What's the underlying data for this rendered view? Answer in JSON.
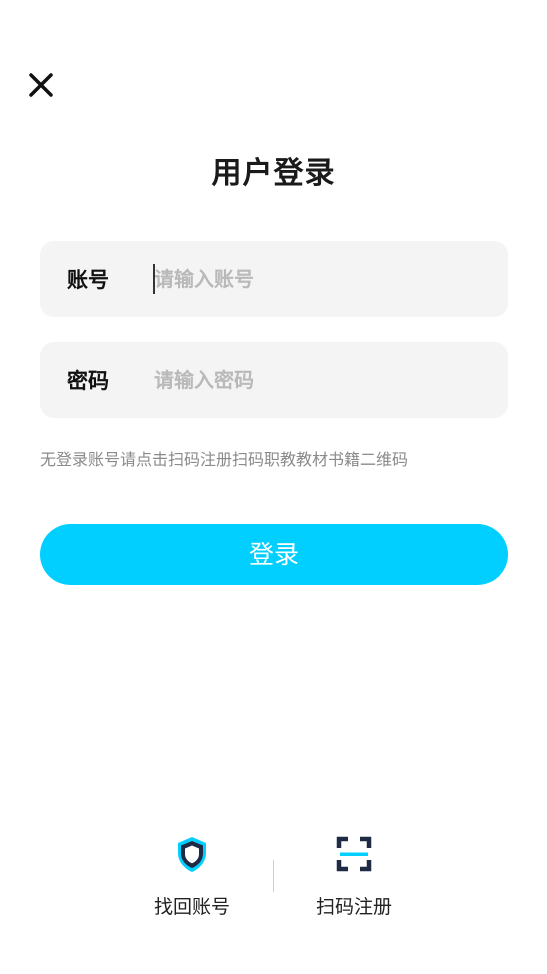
{
  "header": {
    "title": "用户登录"
  },
  "form": {
    "account": {
      "label": "账号",
      "placeholder": "请输入账号"
    },
    "password": {
      "label": "密码",
      "placeholder": "请输入密码"
    },
    "hint": "无登录账号请点击扫码注册扫码职教教材书籍二维码",
    "login_label": "登录"
  },
  "bottom": {
    "recover_label": "找回账号",
    "register_label": "扫码注册"
  },
  "colors": {
    "accent": "#00cfff",
    "field_bg": "#f4f4f4",
    "icon_dark": "#1f2a44"
  },
  "icons": {
    "close": "close-icon",
    "recover": "shield-icon",
    "register": "scan-icon"
  }
}
